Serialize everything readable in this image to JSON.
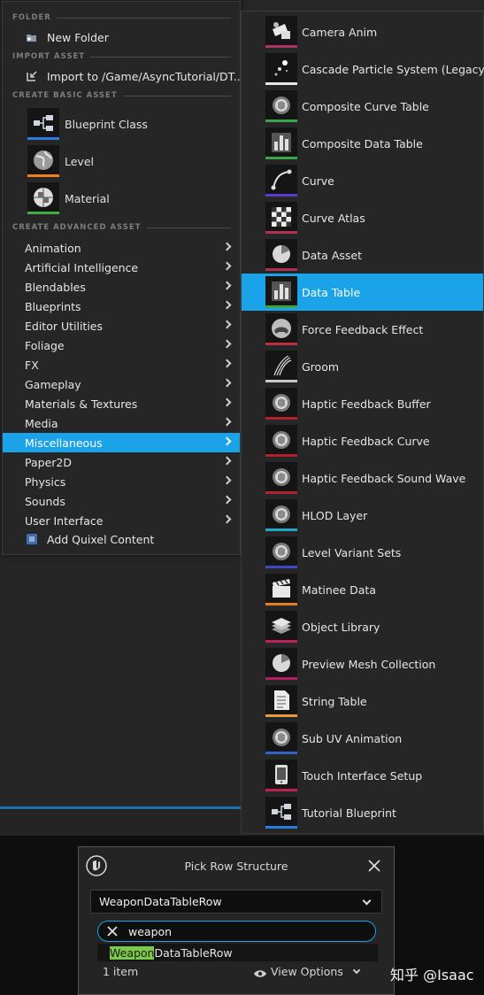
{
  "left_menu": {
    "sections": {
      "folder": "FOLDER",
      "import": "IMPORT ASSET",
      "basic": "CREATE BASIC ASSET",
      "advanced": "CREATE ADVANCED ASSET"
    },
    "new_folder": "New Folder",
    "import_to": "Import to /Game/AsyncTutorial/DT...",
    "basic_assets": [
      {
        "label": "Blueprint Class",
        "icon": "blueprint-icon",
        "color": "#2d7be0"
      },
      {
        "label": "Level",
        "icon": "globe-icon",
        "color": "#f0821e"
      },
      {
        "label": "Material",
        "icon": "material-sphere-icon",
        "color": "#40b040"
      }
    ],
    "categories": [
      "Animation",
      "Artificial Intelligence",
      "Blendables",
      "Blueprints",
      "Editor Utilities",
      "Foliage",
      "FX",
      "Gameplay",
      "Materials & Textures",
      "Media",
      "Miscellaneous",
      "Paper2D",
      "Physics",
      "Sounds",
      "User Interface"
    ],
    "selected_category": "Miscellaneous",
    "quixel": "Add Quixel Content"
  },
  "sub_menu": {
    "selected": "Data Table",
    "items": [
      {
        "label": "Camera Anim",
        "icon": "camera-icon",
        "color": "#b0306a"
      },
      {
        "label": "Cascade Particle System (Legacy)",
        "icon": "particle-icon",
        "color": "#e8e8e8"
      },
      {
        "label": "Composite Curve Table",
        "icon": "generic-asset-icon",
        "color": "#3aa64a"
      },
      {
        "label": "Composite Data Table",
        "icon": "bar-chart-icon",
        "color": "#3aa64a"
      },
      {
        "label": "Curve",
        "icon": "curve-icon",
        "color": "#5a3cc8"
      },
      {
        "label": "Curve Atlas",
        "icon": "checker-icon",
        "color": "#b03050"
      },
      {
        "label": "Data Asset",
        "icon": "pie-icon",
        "color": "#b03050"
      },
      {
        "label": "Data Table",
        "icon": "bar-chart-icon",
        "color": "#3aa64a"
      },
      {
        "label": "Force Feedback Effect",
        "icon": "gamepad-icon",
        "color": "#c03040"
      },
      {
        "label": "Groom",
        "icon": "hair-icon",
        "color": "#c8c8c8"
      },
      {
        "label": "Haptic Feedback Buffer",
        "icon": "generic-asset-icon",
        "color": "#b02030"
      },
      {
        "label": "Haptic Feedback Curve",
        "icon": "generic-asset-icon",
        "color": "#b02030"
      },
      {
        "label": "Haptic Feedback Sound Wave",
        "icon": "generic-asset-icon",
        "color": "#b02030"
      },
      {
        "label": "HLOD Layer",
        "icon": "generic-asset-icon",
        "color": "#20a8c8"
      },
      {
        "label": "Level Variant Sets",
        "icon": "generic-asset-icon",
        "color": "#4048c0"
      },
      {
        "label": "Matinee Data",
        "icon": "clapper-icon",
        "color": "#e08020"
      },
      {
        "label": "Object Library",
        "icon": "stack-icon",
        "color": "#c02060"
      },
      {
        "label": "Preview Mesh Collection",
        "icon": "pie-icon",
        "color": "#b02060"
      },
      {
        "label": "String Table",
        "icon": "document-icon",
        "color": "#e89a3a"
      },
      {
        "label": "Sub UV Animation",
        "icon": "generic-asset-icon",
        "color": "#3060c8"
      },
      {
        "label": "Touch Interface Setup",
        "icon": "phone-icon",
        "color": "#c02050"
      },
      {
        "label": "Tutorial Blueprint",
        "icon": "blueprint-icon",
        "color": "#2d7be0"
      }
    ]
  },
  "dialog": {
    "title": "Pick Row Structure",
    "selected_struct": "WeaponDataTableRow",
    "search_value": "weapon",
    "result_highlight": "Weapon",
    "result_rest": "DataTableRow",
    "status": "1 item",
    "view_options": "View Options"
  },
  "watermark": "知乎 @Isaac"
}
